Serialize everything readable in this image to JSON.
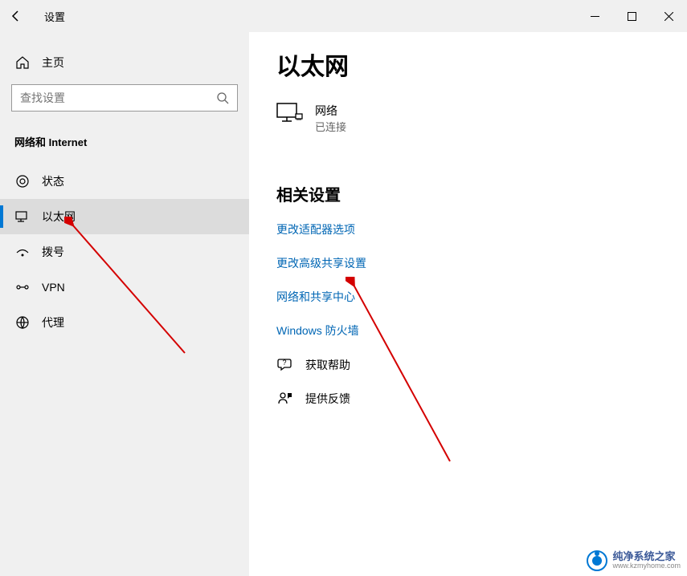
{
  "titlebar": {
    "title": "设置"
  },
  "sidebar": {
    "home": "主页",
    "search_placeholder": "查找设置",
    "category": "网络和 Internet",
    "items": [
      {
        "label": "状态"
      },
      {
        "label": "以太网"
      },
      {
        "label": "拨号"
      },
      {
        "label": "VPN"
      },
      {
        "label": "代理"
      }
    ]
  },
  "main": {
    "title": "以太网",
    "network": {
      "name": "网络",
      "status": "已连接"
    },
    "related_header": "相关设置",
    "links": [
      "更改适配器选项",
      "更改高级共享设置",
      "网络和共享中心",
      "Windows 防火墙"
    ],
    "helpers": [
      {
        "label": "获取帮助"
      },
      {
        "label": "提供反馈"
      }
    ]
  },
  "watermark": {
    "name": "纯净系统之家",
    "url": "www.kzmyhome.com"
  }
}
